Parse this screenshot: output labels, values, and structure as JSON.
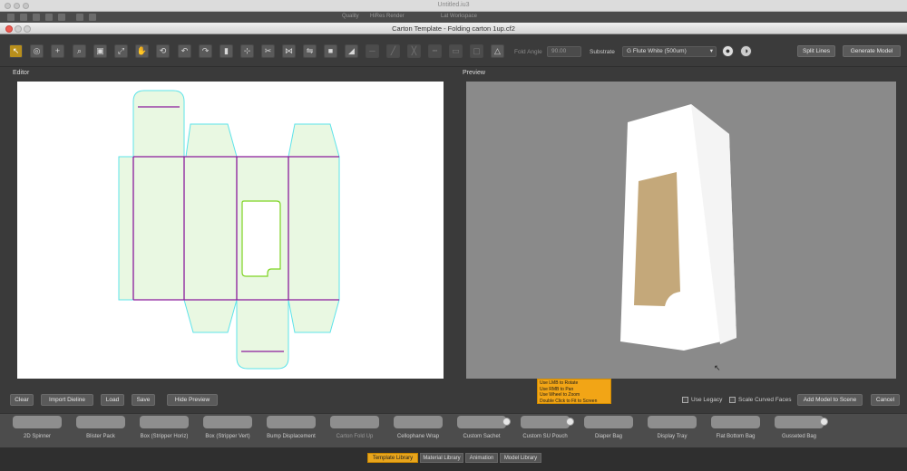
{
  "os_window": {
    "title": "Untitled.iu3"
  },
  "app_toolbar": {
    "items": [
      "Quality",
      "HiRes Render",
      "Lat Workspace"
    ]
  },
  "dialog": {
    "title": "Carton Template - Folding carton 1up.cf2"
  },
  "toolbar": {
    "fold_angle_label": "Fold Angle",
    "fold_angle_value": "90.00",
    "substrate_label": "Substrate",
    "substrate_value": "G Flute White (500um)",
    "split_lines": "Split Lines",
    "generate_model": "Generate Model"
  },
  "editor": {
    "label": "Editor"
  },
  "preview": {
    "label": "Preview",
    "tooltip": [
      "Use LMB to Rotate",
      "Use RMB to Pan",
      "Use Wheel to Zoom",
      "Double Click to Fit to Screen"
    ]
  },
  "bottom": {
    "clear": "Clear",
    "import_dieline": "Import Dieline",
    "load": "Load",
    "save": "Save",
    "hide_preview": "Hide Preview",
    "use_legacy": "Use Legacy",
    "scale_curved": "Scale Curved Faces",
    "add_model": "Add Model to Scene",
    "cancel": "Cancel"
  },
  "library": {
    "templates": [
      "2D Spinner",
      "Blister Pack",
      "Box (Stripper Horiz)",
      "Box (Stripper Vert)",
      "Bump Displacement",
      "Carton Fold Up",
      "Cellophane Wrap",
      "Custom Sachet",
      "Custom SU Pouch",
      "Diaper Bag",
      "Display Tray",
      "Flat Bottom Bag",
      "Gusseted Bag"
    ],
    "tabs": [
      "Template Library",
      "Material Library",
      "Animation",
      "Model Library"
    ]
  },
  "colors": {
    "accent": "#e8a51c",
    "dieline_cut": "#5ee3ea",
    "dieline_crease": "#8a1a9c",
    "dieline_window": "#7ed321",
    "panel_fill": "#e9f8e2",
    "window_kraft": "#c4a87a"
  }
}
